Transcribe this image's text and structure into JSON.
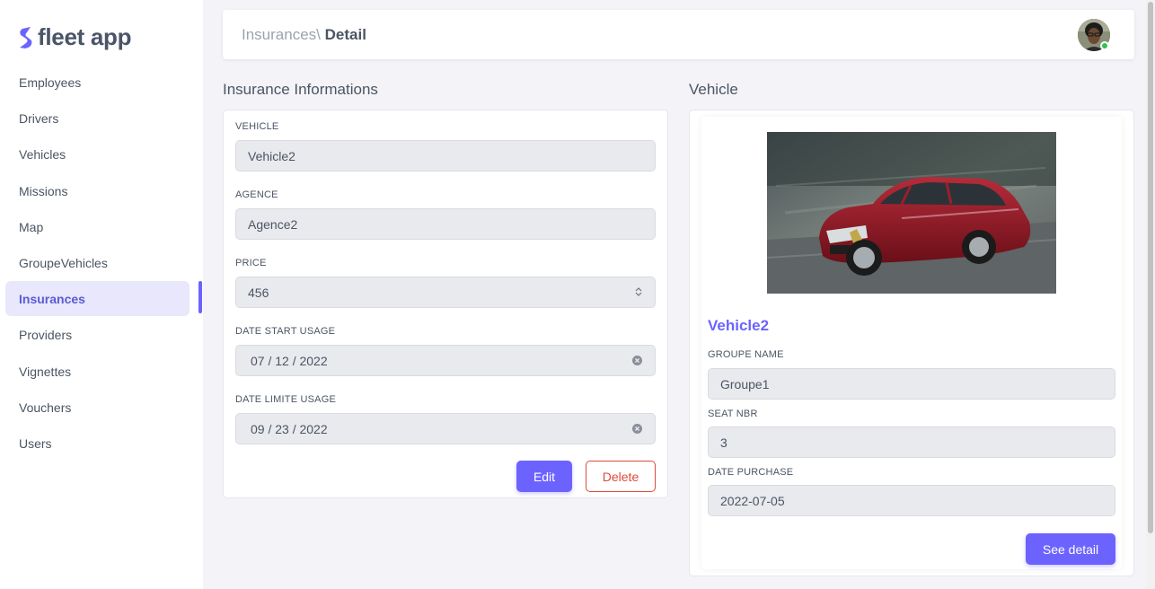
{
  "app": {
    "name": "fleet app",
    "brand_color": "#6c63ff"
  },
  "sidebar": {
    "items": [
      {
        "label": "Employees"
      },
      {
        "label": "Drivers"
      },
      {
        "label": "Vehicles"
      },
      {
        "label": "Missions"
      },
      {
        "label": "Map"
      },
      {
        "label": "GroupeVehicles"
      },
      {
        "label": "Insurances",
        "active": true
      },
      {
        "label": "Providers"
      },
      {
        "label": "Vignettes"
      },
      {
        "label": "Vouchers"
      },
      {
        "label": "Users"
      }
    ]
  },
  "header": {
    "breadcrumb_parent": "Insurances\\",
    "breadcrumb_current": "Detail",
    "avatar_status": "online",
    "avatar_status_color": "#31c24d"
  },
  "insurance": {
    "title": "Insurance Informations",
    "fields": [
      {
        "label": "VEHICLE",
        "value": "Vehicle2"
      },
      {
        "label": "AGENCE",
        "value": "Agence2"
      },
      {
        "label": "PRICE",
        "value": "456",
        "icon": "spinner-icon"
      },
      {
        "label": "DATE START USAGE",
        "value": "07 / 12 / 2022",
        "icon": "clear-icon"
      },
      {
        "label": "DATE LIMITE USAGE",
        "value": "09 / 23 / 2022",
        "icon": "clear-icon"
      }
    ],
    "edit_label": "Edit",
    "delete_label": "Delete",
    "delete_color": "#e0483c"
  },
  "vehicle": {
    "title": "Vehicle",
    "name": "Vehicle2",
    "fields": [
      {
        "label": "GROUPE NAME",
        "value": "Groupe1"
      },
      {
        "label": "SEAT NBR",
        "value": "3"
      },
      {
        "label": "DATE PURCHASE",
        "value": "2022-07-05"
      }
    ],
    "detail_label": "See detail"
  }
}
